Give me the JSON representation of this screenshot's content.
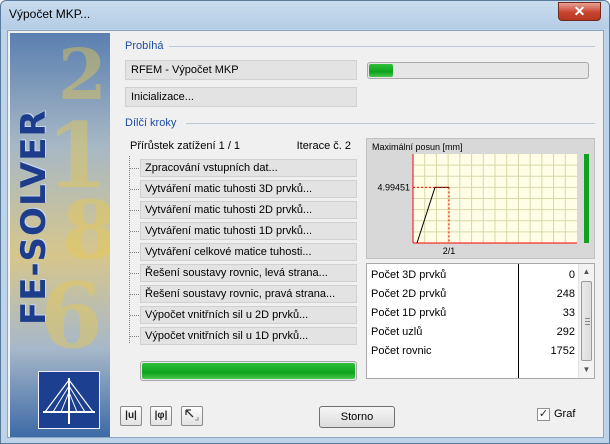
{
  "window": {
    "title": "Výpočet MKP...",
    "close": "✕"
  },
  "banner": {
    "text": "FE-SOLVER"
  },
  "running": {
    "section": "Probíhá",
    "task": "RFEM - Výpočet MKP",
    "phase": "Inicializace...",
    "progress": 0.12
  },
  "steps": {
    "section": "Dílčí kroky",
    "increment": "Přírůstek zatížení 1 / 1",
    "iteration": "Iterace č. 2",
    "items": [
      "Zpracování vstupních dat...",
      "Vytváření matic tuhosti 3D prvků...",
      "Vytváření matic tuhosti 2D prvků...",
      "Vytváření matic tuhosti 1D prvků...",
      "Vytváření celkové matice tuhosti...",
      "Řešení soustavy rovnic, levá strana...",
      "Řešení soustavy rovnic, pravá strana...",
      "Výpočet vnitřních sil u 2D prvků...",
      "Výpočet vnitřních sil u 1D prvků..."
    ],
    "progress": 1.0
  },
  "chart_data": {
    "type": "line",
    "title": "Maximální posun [mm]",
    "x_tick": "2/1",
    "y_tick": "4.99451",
    "points": [
      [
        0,
        0
      ],
      [
        1,
        4.99451
      ]
    ],
    "x_marker": 1,
    "grid": true,
    "line_color": "#000000",
    "marker_color": "#ff0000",
    "level_bar_color": "#11a020"
  },
  "info": {
    "rows": [
      {
        "label": "Počet 3D prvků",
        "value": "0"
      },
      {
        "label": "Počet 2D prvků",
        "value": "248"
      },
      {
        "label": "Počet 1D prvků",
        "value": "33"
      },
      {
        "label": "Počet uzlů",
        "value": "292"
      },
      {
        "label": "Počet rovnic",
        "value": "1752"
      }
    ]
  },
  "toolbar": {
    "btn1_icon": "units-icon",
    "btn1": "|u|",
    "btn2_icon": "rotation-icon",
    "btn2": "|φ|",
    "btn3_icon": "pointer-icon"
  },
  "footer": {
    "cancel": "Storno",
    "graph_label": "Graf",
    "graph_checked": true
  },
  "colors": {
    "accent": "#1f4aa0",
    "progress": "#0ea21c",
    "chart_bg": "#fffde6",
    "grid": "#d8d8a8"
  }
}
